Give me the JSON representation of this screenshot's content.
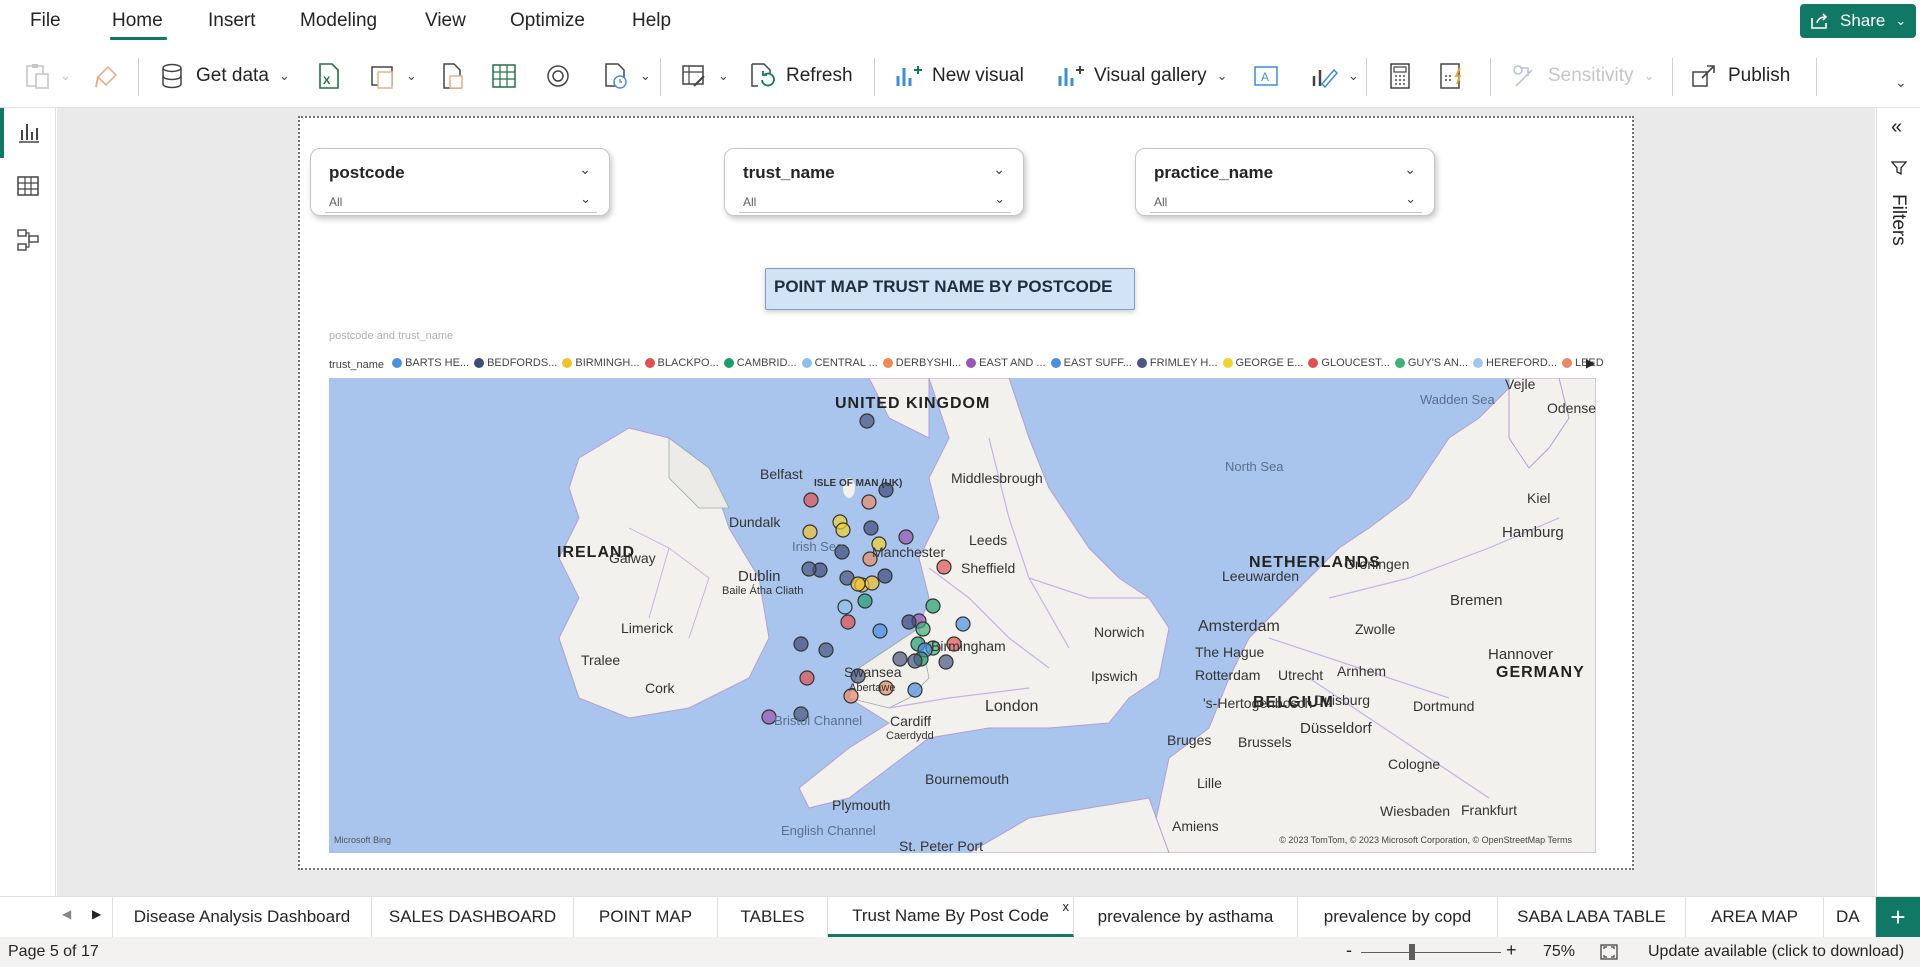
{
  "menu": {
    "items": [
      "File",
      "Home",
      "Insert",
      "Modeling",
      "View",
      "Optimize",
      "Help"
    ],
    "active": "Home",
    "share_label": "Share"
  },
  "ribbon": {
    "get_data": "Get data",
    "refresh": "Refresh",
    "new_visual": "New visual",
    "visual_gallery": "Visual gallery",
    "sensitivity": "Sensitivity",
    "publish": "Publish"
  },
  "slicers": [
    {
      "title": "postcode",
      "value": "All"
    },
    {
      "title": "trust_name",
      "value": "All"
    },
    {
      "title": "practice_name",
      "value": "All"
    }
  ],
  "report_title": "POINT MAP TRUST NAME BY POSTCODE",
  "map": {
    "caption": "postcode and trust_name",
    "legend_title": "trust_name",
    "legend": [
      {
        "label": "BARTS HE...",
        "color": "#4a8fe0"
      },
      {
        "label": "BEDFORDS...",
        "color": "#3e4a7a"
      },
      {
        "label": "BIRMINGH...",
        "color": "#f2c12e"
      },
      {
        "label": "BLACKPO...",
        "color": "#e0514f"
      },
      {
        "label": "CAMBRID...",
        "color": "#1f9e6d"
      },
      {
        "label": "CENTRAL ...",
        "color": "#8ec0e8"
      },
      {
        "label": "DERBYSHI...",
        "color": "#f08a54"
      },
      {
        "label": "EAST AND ...",
        "color": "#9a56b0"
      },
      {
        "label": "EAST SUFF...",
        "color": "#4a8fe0"
      },
      {
        "label": "FRIMLEY H...",
        "color": "#4a5680"
      },
      {
        "label": "GEORGE E...",
        "color": "#f2d22e"
      },
      {
        "label": "GLOUCEST...",
        "color": "#e0514f"
      },
      {
        "label": "GUY'S AN...",
        "color": "#3fb07a"
      },
      {
        "label": "HEREFORD...",
        "color": "#9fc8ee"
      },
      {
        "label": "LEEDS TEA...",
        "color": "#e88a66"
      }
    ],
    "labels": {
      "countries": [
        "UNITED KINGDOM",
        "IRELAND",
        "NETHERLANDS",
        "BELGIUM",
        "GERMANY",
        "ISLE OF MAN (UK)"
      ],
      "seas": [
        "North Sea",
        "Irish Sea",
        "Bristol Channel",
        "English Channel",
        "Wadden Sea"
      ],
      "cities": [
        "Middlesbrough",
        "Belfast",
        "Dundalk",
        "Galway",
        "Dublin",
        "Baile Átha Cliath",
        "Limerick",
        "Tralee",
        "Cork",
        "Leeds",
        "Manchester",
        "Sheffield",
        "Birmingham",
        "Norwich",
        "Ipswich",
        "Swansea",
        "Abertawe",
        "Cardiff",
        "Caerdydd",
        "London",
        "Bournemouth",
        "Plymouth",
        "St. Peter Port",
        "Amsterdam",
        "The Hague",
        "Rotterdam",
        "Utrecht",
        "Arnhem",
        "'s-Hertogenbosch",
        "Duisburg",
        "Dortmund",
        "Düsseldorf",
        "Bruges",
        "Brussels",
        "Cologne",
        "Lille",
        "Amiens",
        "Wiesbaden",
        "Frankfurt",
        "Leeuwarden",
        "Groningen",
        "Zwolle",
        "Bremen",
        "Hannover",
        "Hamburg",
        "Kiel",
        "Odense",
        "Vejle"
      ]
    },
    "attribution": "© 2023 TomTom, © 2023 Microsoft Corporation, © OpenStreetMap  Terms",
    "logo": "Microsoft Bing"
  },
  "filters_label": "Filters",
  "tabs": [
    "Disease Analysis Dashboard",
    "SALES DASHBOARD",
    "POINT MAP",
    "TABLES",
    "Trust Name By Post Code",
    "prevalence by asthama",
    "prevalence by copd",
    "SABA LABA TABLE",
    "AREA MAP",
    "DA"
  ],
  "active_tab": "Trust Name By Post Code",
  "status": {
    "page": "Page 5 of 17",
    "zoom": "75%",
    "update": "Update available (click to download)"
  }
}
